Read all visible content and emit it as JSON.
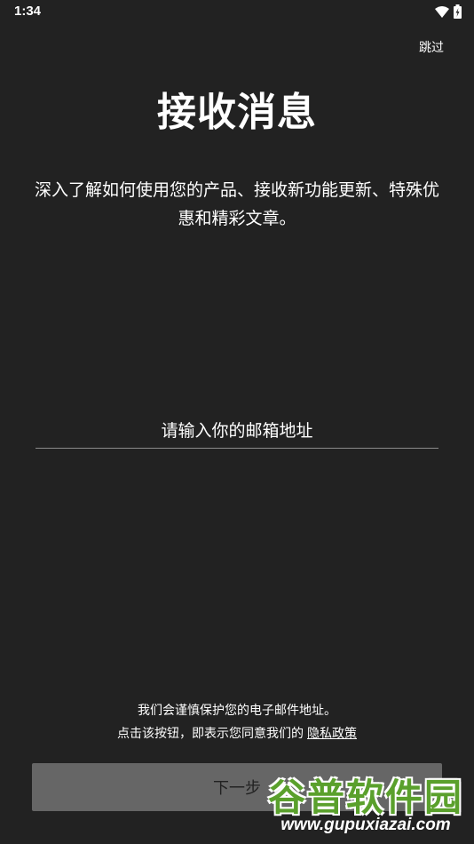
{
  "status_bar": {
    "time": "1:34",
    "icons": [
      "wifi-icon",
      "battery-charging-icon"
    ]
  },
  "header": {
    "skip_label": "跳过"
  },
  "main": {
    "title": "接收消息",
    "description": "深入了解如何使用您的产品、接收新功能更新、特殊优惠和精彩文章。",
    "email_placeholder": "请输入你的邮箱地址",
    "email_value": ""
  },
  "footer": {
    "privacy_line1": "我们会谨慎保护您的电子邮件地址。",
    "privacy_line2": "点击该按钮，即表示您同意我们的",
    "privacy_link": "隐私政策",
    "next_label": "下一步"
  },
  "watermark": {
    "text": "谷普软件园",
    "url": "www.gupuxiazai.com"
  },
  "colors": {
    "background": "#222222",
    "button_disabled": "#666666",
    "watermark_green": "#5aa02c"
  }
}
